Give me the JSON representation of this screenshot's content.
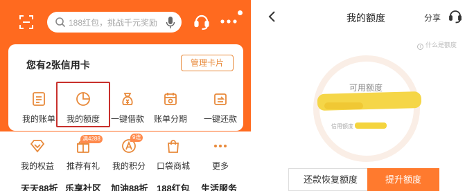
{
  "left": {
    "search_placeholder": "188红包，挑战千元奖励",
    "card_title": "您有2张信用卡",
    "manage_label": "管理卡片",
    "grid": [
      {
        "label": "我的账单",
        "icon": "bill-icon"
      },
      {
        "label": "我的额度",
        "icon": "quota-pie-icon"
      },
      {
        "label": "一键借款",
        "icon": "loan-bag-icon"
      },
      {
        "label": "账单分期",
        "icon": "installment-calendar-icon"
      },
      {
        "label": "一键还款",
        "icon": "repay-icon"
      }
    ],
    "grid2": [
      {
        "label": "我的权益",
        "icon": "rights-diamond-icon"
      },
      {
        "label": "推荐有礼",
        "icon": "gift-icon",
        "tag": "满4288"
      },
      {
        "label": "我的积分",
        "icon": "points-icon",
        "tag": "9连"
      },
      {
        "label": "口袋商城",
        "icon": "mall-bag-icon"
      },
      {
        "label": "更多",
        "icon": "more-dots-icon"
      }
    ],
    "promos": [
      "天天88折",
      "乐享社区",
      "加油88折",
      "188红包",
      "生活服务"
    ]
  },
  "right": {
    "title": "我的额度",
    "share": "分享",
    "what_link": "什么是额度",
    "available_label": "可用额度",
    "credit_label": "信用额度",
    "restore_button": "还款恢复额度",
    "raise_button": "提升额度"
  },
  "colors": {
    "brand_orange": "#ff6a1f",
    "highlight_red": "#c8302c",
    "redaction_yellow": "#f4d43e"
  }
}
